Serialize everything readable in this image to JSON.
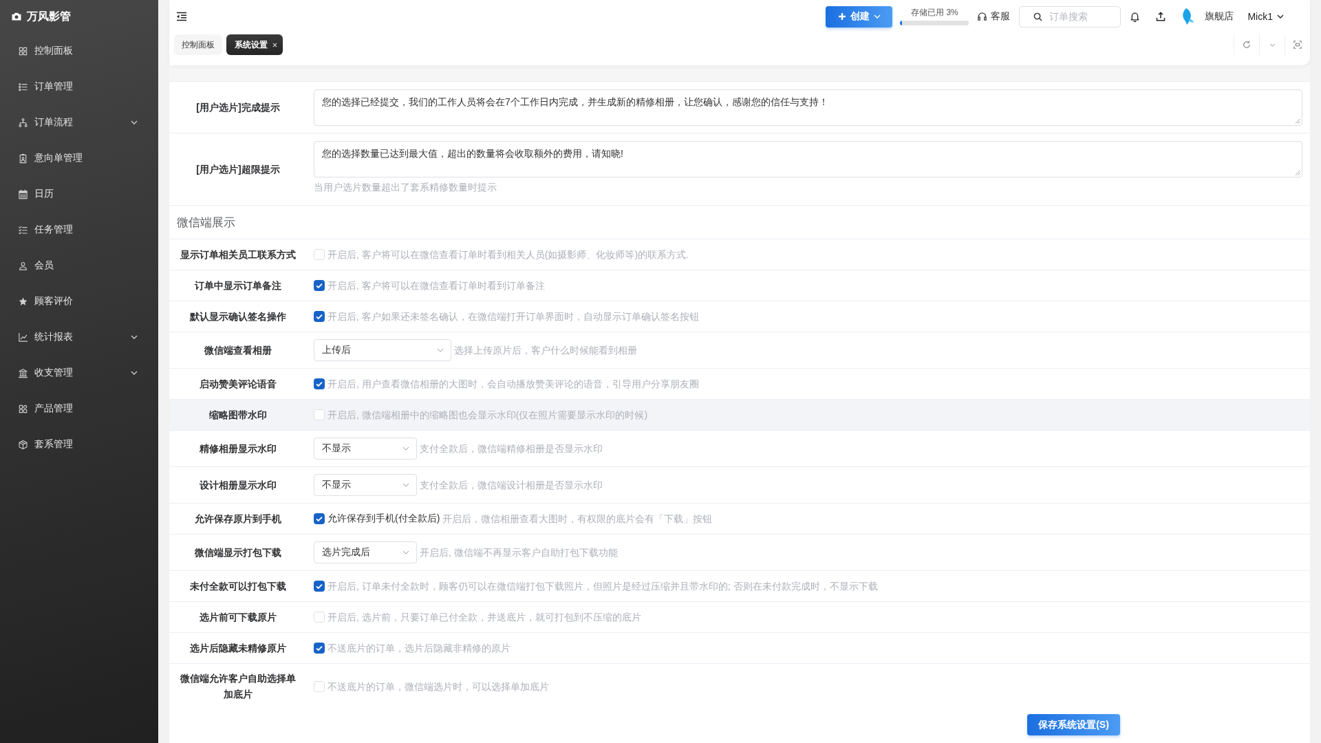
{
  "sidebar": {
    "brand": "万风影管",
    "items": [
      {
        "label": "控制面板",
        "expandable": false
      },
      {
        "label": "订单管理",
        "expandable": false
      },
      {
        "label": "订单流程",
        "expandable": true
      },
      {
        "label": "意向单管理",
        "expandable": false
      },
      {
        "label": "日历",
        "expandable": false
      },
      {
        "label": "任务管理",
        "expandable": false
      },
      {
        "label": "会员",
        "expandable": false
      },
      {
        "label": "顾客评价",
        "expandable": false
      },
      {
        "label": "统计报表",
        "expandable": true
      },
      {
        "label": "收支管理",
        "expandable": true
      },
      {
        "label": "产品管理",
        "expandable": false
      },
      {
        "label": "套系管理",
        "expandable": false
      }
    ]
  },
  "header": {
    "create_button": "创建",
    "storage": {
      "label": "存储已用 3%",
      "level": 0.03
    },
    "support": "客服",
    "search": {
      "placeholder": "订单搜索"
    },
    "store": "旗舰店",
    "user": "Mick1"
  },
  "tabs": [
    {
      "label": "控制面板",
      "selected": false,
      "closable": false
    },
    {
      "label": "系统设置",
      "selected": true,
      "closable": true
    }
  ],
  "prompts": [
    {
      "label": "[用户选片]完成提示",
      "value": "您的选择已经提交，我们的工作人员将会在7个工作日内完成，并生成新的精修相册，让您确认，感谢您的信任与支持！"
    },
    {
      "label": "[用户选片]超限提示",
      "value": "您的选择数量已达到最大值，超出的数量将会收取额外的费用，请知晓!",
      "hint": "当用户选片数量超出了套系精修数量时提示"
    }
  ],
  "section_title": "微信端展示",
  "settings": [
    {
      "kind": "checkbox",
      "label": "显示订单相关员工联系方式",
      "checked": false,
      "hint": "开启后, 客户将可以在微信查看订单时看到相关人员(如摄影师、化妆师等)的联系方式.",
      "hovered": false
    },
    {
      "kind": "checkbox",
      "label": "订单中显示订单备注",
      "checked": true,
      "hint": "开启后, 客户将可以在微信查看订单时看到订单备注",
      "hovered": false
    },
    {
      "kind": "checkbox",
      "label": "默认显示确认签名操作",
      "checked": true,
      "hint": "开启后, 客户如果还未签名确认，在微信端打开订单界面时，自动显示订单确认签名按钮",
      "hovered": false
    },
    {
      "kind": "select",
      "label": "微信端查看相册",
      "value": "上传后",
      "hint": "选择上传原片后，客户什么时候能看到相册",
      "hovered": false
    },
    {
      "kind": "checkbox",
      "label": "启动赞美评论语音",
      "checked": true,
      "hint": "开启后, 用户查看微信相册的大图时，会自动播放赞美评论的语音，引导用户分享朋友圈",
      "hovered": false
    },
    {
      "kind": "checkbox",
      "label": "缩略图带水印",
      "checked": false,
      "hint": "开启后, 微信端相册中的缩略图也会显示水印(仅在照片需要显示水印的时候)",
      "hovered": true
    },
    {
      "kind": "select",
      "label": "精修相册显示水印",
      "value": "不显示",
      "hint": "支付全款后，微信端精修相册是否显示水印",
      "hovered": false
    },
    {
      "kind": "select",
      "label": "设计相册显示水印",
      "value": "不显示",
      "hint": "支付全款后，微信端设计相册是否显示水印",
      "hovered": false
    },
    {
      "kind": "checkbox",
      "label": "允许保存原片到手机",
      "checked": true,
      "option": "允许保存到手机(付全款后)",
      "hint": "开启后，微信相册查看大图时，有权限的底片会有「下载」按钮",
      "hovered": false
    },
    {
      "kind": "select",
      "label": "微信端显示打包下载",
      "value": "选片完成后",
      "hint": "开启后, 微信端不再显示客户自助打包下载功能",
      "hovered": false
    },
    {
      "kind": "checkbox",
      "label": "未付全款可以打包下载",
      "checked": true,
      "hint": "开启后, 订单未付全款时，顾客仍可以在微信端打包下载照片，但照片是经过压缩并且带水印的; 否则在未付款完成时，不显示下载",
      "hovered": false
    },
    {
      "kind": "checkbox",
      "label": "选片前可下载原片",
      "checked": false,
      "hint": "开启后, 选片前，只要订单已付全款，并送底片，就可打包到不压缩的底片",
      "hovered": false
    },
    {
      "kind": "checkbox",
      "label": "选片后隐藏未精修原片",
      "checked": true,
      "hint": "不送底片的订单，选片后隐藏非精修的原片",
      "hovered": false
    },
    {
      "kind": "checkbox",
      "label": "微信端允许客户自助选择单加底片",
      "checked": false,
      "hint": "不送底片的订单，微信端选片时，可以选择单加底片",
      "hovered": false
    }
  ],
  "save_button": "保存系统设置(S)"
}
